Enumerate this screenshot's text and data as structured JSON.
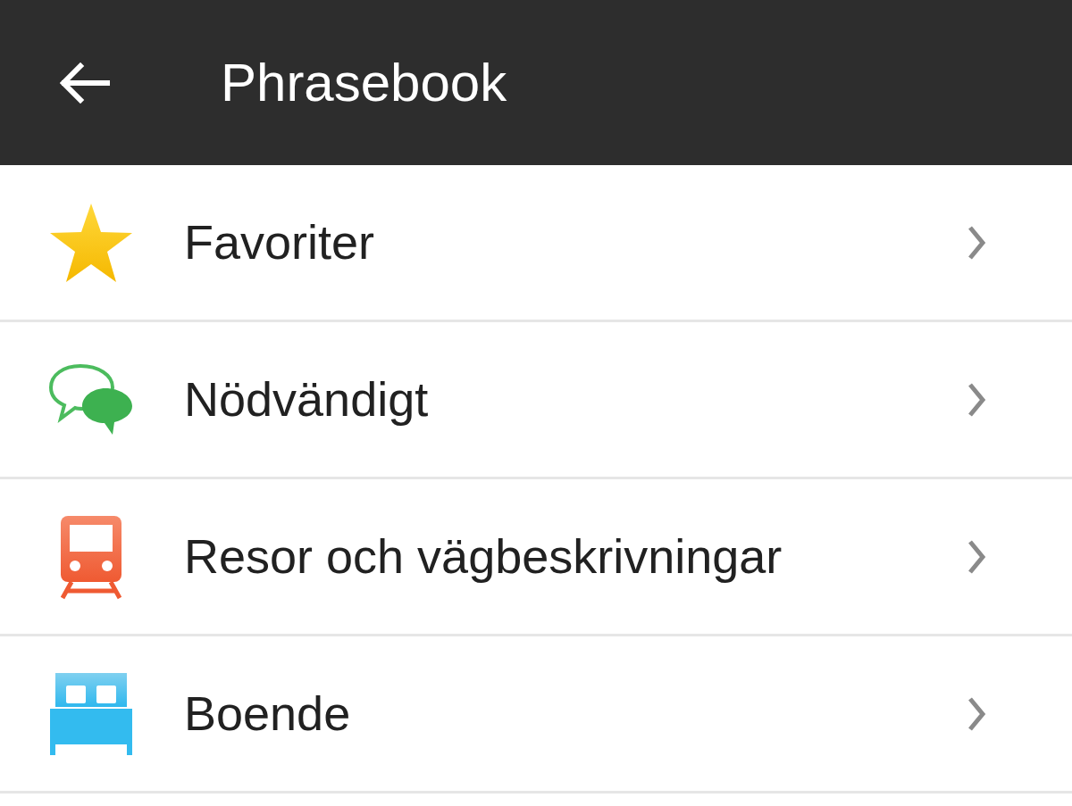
{
  "app_bar": {
    "title": "Phrasebook"
  },
  "categories": [
    {
      "label": "Favoriter"
    },
    {
      "label": "Nödvändigt"
    },
    {
      "label": "Resor och vägbeskrivningar"
    },
    {
      "label": "Boende"
    }
  ]
}
